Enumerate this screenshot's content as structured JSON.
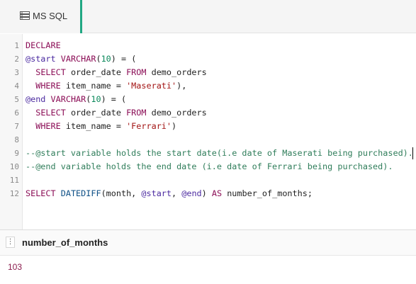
{
  "tab": {
    "label": "MS SQL",
    "icon": "database-icon",
    "accent": "#21a883"
  },
  "editor": {
    "lines": [
      {
        "n": "1",
        "tokens": [
          [
            "kw",
            "DECLARE"
          ]
        ]
      },
      {
        "n": "2",
        "tokens": [
          [
            "var",
            "@start"
          ],
          [
            "punc",
            " "
          ],
          [
            "kw",
            "VARCHAR"
          ],
          [
            "punc",
            "("
          ],
          [
            "num",
            "10"
          ],
          [
            "punc",
            ") = ("
          ]
        ]
      },
      {
        "n": "3",
        "tokens": [
          [
            "punc",
            "  "
          ],
          [
            "kw",
            "SELECT"
          ],
          [
            "punc",
            " order_date "
          ],
          [
            "kw",
            "FROM"
          ],
          [
            "punc",
            " demo_orders"
          ]
        ]
      },
      {
        "n": "4",
        "tokens": [
          [
            "punc",
            "  "
          ],
          [
            "kw",
            "WHERE"
          ],
          [
            "punc",
            " item_name = "
          ],
          [
            "str",
            "'Maserati'"
          ],
          [
            "punc",
            "),"
          ]
        ]
      },
      {
        "n": "5",
        "tokens": [
          [
            "var",
            "@end"
          ],
          [
            "punc",
            " "
          ],
          [
            "kw",
            "VARCHAR"
          ],
          [
            "punc",
            "("
          ],
          [
            "num",
            "10"
          ],
          [
            "punc",
            ") = ("
          ]
        ]
      },
      {
        "n": "6",
        "tokens": [
          [
            "punc",
            "  "
          ],
          [
            "kw",
            "SELECT"
          ],
          [
            "punc",
            " order_date "
          ],
          [
            "kw",
            "FROM"
          ],
          [
            "punc",
            " demo_orders"
          ]
        ]
      },
      {
        "n": "7",
        "tokens": [
          [
            "punc",
            "  "
          ],
          [
            "kw",
            "WHERE"
          ],
          [
            "punc",
            " item_name = "
          ],
          [
            "str",
            "'Ferrari'"
          ],
          [
            "punc",
            ")"
          ]
        ]
      },
      {
        "n": "8",
        "tokens": []
      },
      {
        "n": "9",
        "tokens": [
          [
            "cmt",
            "--@start variable holds the start date(i.e date of Maserati being purchased)."
          ]
        ]
      },
      {
        "n": "10",
        "tokens": [
          [
            "cmt",
            "--@end variable holds the end date (i.e date of Ferrari being purchased)."
          ]
        ]
      },
      {
        "n": "11",
        "tokens": []
      },
      {
        "n": "12",
        "tokens": [
          [
            "kw",
            "SELECT"
          ],
          [
            "punc",
            " "
          ],
          [
            "fn",
            "DATEDIFF"
          ],
          [
            "punc",
            "(month, "
          ],
          [
            "var",
            "@start"
          ],
          [
            "punc",
            ", "
          ],
          [
            "var",
            "@end"
          ],
          [
            "punc",
            ") "
          ],
          [
            "kw",
            "AS"
          ],
          [
            "punc",
            " number_of_months;"
          ]
        ]
      }
    ]
  },
  "result": {
    "column": "number_of_months",
    "value": "103",
    "icon": "column-menu-icon"
  }
}
